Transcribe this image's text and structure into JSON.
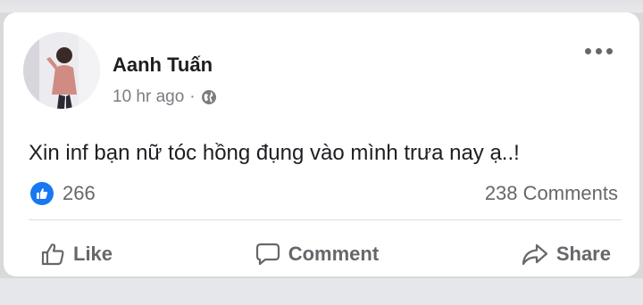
{
  "post": {
    "author": "Aanh Tuấn",
    "time": "10 hr ago",
    "separator": "·",
    "privacy_icon": "globe-icon",
    "text": "Xin inf bạn nữ tóc hồng đụng vào mình trưa nay ạ..!",
    "reaction_icon": "like-reaction-icon",
    "reaction_count": "266",
    "comment_count": "238 Comments"
  },
  "actions": {
    "like_label": "Like",
    "comment_label": "Comment",
    "share_label": "Share"
  },
  "colors": {
    "accent": "#1877f2",
    "text": "#1c1e21",
    "muted": "#65676b",
    "card": "#ffffff"
  }
}
